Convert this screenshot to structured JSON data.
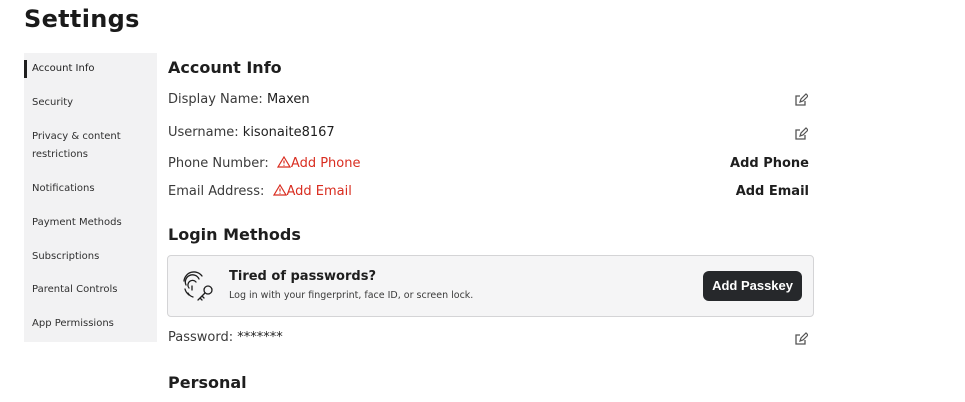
{
  "page": {
    "title": "Settings"
  },
  "sidebar": {
    "items": [
      {
        "label": "Account Info",
        "active": true
      },
      {
        "label": "Security"
      },
      {
        "label": "Privacy & content restrictions"
      },
      {
        "label": "Notifications"
      },
      {
        "label": "Payment Methods"
      },
      {
        "label": "Subscriptions"
      },
      {
        "label": "Parental Controls"
      },
      {
        "label": "App Permissions"
      }
    ]
  },
  "account_info": {
    "title": "Account Info",
    "display_name": {
      "label": "Display Name:",
      "value": "Maxen"
    },
    "username": {
      "label": "Username:",
      "value": "kisonaite8167"
    },
    "phone": {
      "label": "Phone Number:",
      "warning": "Add Phone",
      "action": "Add Phone"
    },
    "email": {
      "label": "Email Address:",
      "warning": "Add Email",
      "action": "Add Email"
    }
  },
  "login_methods": {
    "title": "Login Methods",
    "passkey": {
      "title": "Tired of passwords?",
      "subtitle": "Log in with your fingerprint, face ID, or screen lock.",
      "button": "Add Passkey"
    },
    "password": {
      "label": "Password:",
      "value": "*******"
    }
  },
  "personal": {
    "title": "Personal"
  },
  "colors": {
    "warning": "#d92d20",
    "button_bg": "#26282b",
    "sidebar_bg": "#f2f2f3"
  },
  "icons": [
    "edit-icon",
    "warning-icon",
    "fingerprint-key-icon"
  ]
}
